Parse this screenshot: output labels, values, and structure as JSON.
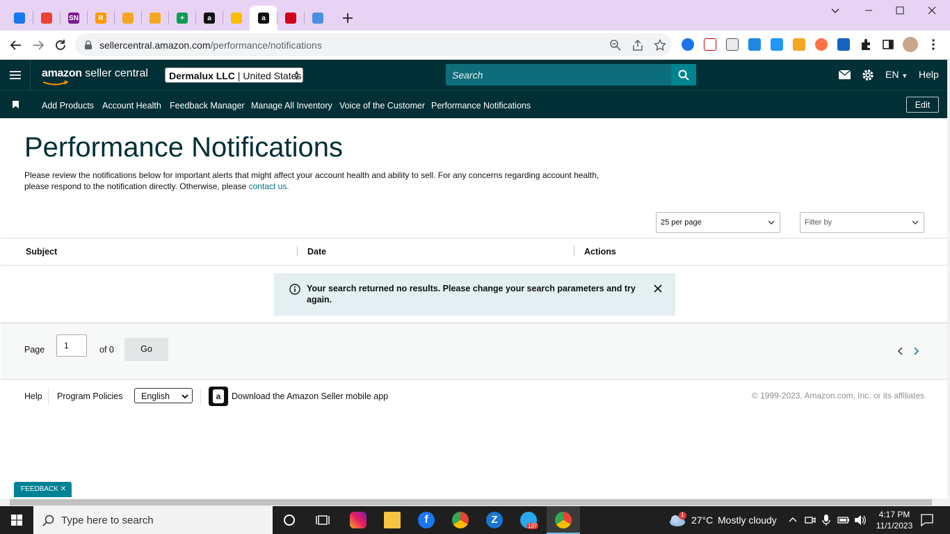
{
  "browser": {
    "tabs": [
      {
        "icon": "facebook-icon",
        "color": "#1877f2"
      },
      {
        "icon": "gmail-icon",
        "color": "#ea4335"
      },
      {
        "icon": "sn-icon",
        "color": "#7b1c8f",
        "text": "SN"
      },
      {
        "icon": "r-icon",
        "color": "#ff9900",
        "text": "R"
      },
      {
        "icon": "flame-icon",
        "color": "#f5a623"
      },
      {
        "icon": "flame-icon",
        "color": "#f5a623"
      },
      {
        "icon": "sheets-icon",
        "color": "#0f9d58",
        "text": "+"
      },
      {
        "icon": "amazon-icon",
        "color": "#111111",
        "text": "a"
      },
      {
        "icon": "grid-icon",
        "color": "#fbbc05"
      },
      {
        "icon": "amazon-icon",
        "color": "#111111",
        "text": "a",
        "active": true
      },
      {
        "icon": "triangle-icon",
        "color": "#d0021b"
      },
      {
        "icon": "pencil-icon",
        "color": "#4a90e2"
      }
    ],
    "url_host": "sellercentral.amazon.com",
    "url_path": "/performance/notifications"
  },
  "header": {
    "logo_text": "amazon",
    "logo_suffix": " seller central",
    "store_bold": "Dermalux LLC",
    "store_rest": " | United States",
    "search_placeholder": "Search",
    "lang": "EN",
    "help": "Help"
  },
  "nav": {
    "items": [
      "Add Products",
      "Account Health",
      "Feedback Manager",
      "Manage All Inventory",
      "Voice of the Customer",
      "Performance Notifications"
    ],
    "edit": "Edit"
  },
  "page": {
    "title": "Performance Notifications",
    "intro": "Please review the notifications below for important alerts that might affect your account health and ability to sell. For any concerns regarding account health, please respond to the notification directly. Otherwise, please ",
    "contact_link": "contact us.",
    "per_page": "25 per page",
    "filter_placeholder": "Filter by",
    "columns": [
      "Subject",
      "Date",
      "Actions"
    ],
    "alert": "Your search returned no results. Please change your search parameters and try again.",
    "pager": {
      "label": "Page",
      "value": "1",
      "of": "of 0",
      "go": "Go"
    }
  },
  "footer": {
    "help": "Help",
    "policies": "Program Policies",
    "language": "English",
    "app_text": "Download the Amazon Seller mobile app",
    "copyright": "© 1999-2023, Amazon.com, Inc. or its affiliates",
    "feedback": "FEEDBACK"
  },
  "taskbar": {
    "search_placeholder": "Type here to search",
    "weather_badge": "1",
    "temperature": "27°C",
    "weather": "Mostly cloudy",
    "telegram_badge": "137",
    "time": "4:17 PM",
    "date": "11/1/2023"
  }
}
